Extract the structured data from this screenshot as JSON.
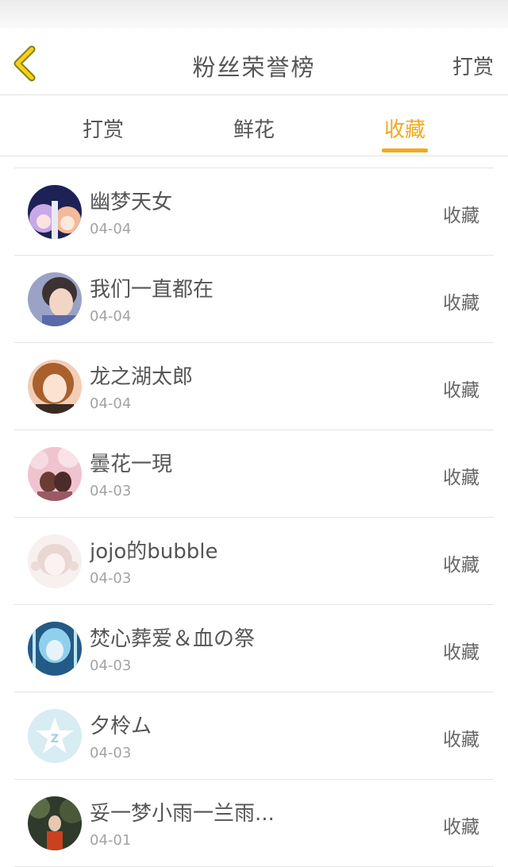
{
  "header": {
    "title": "粉丝荣誉榜",
    "right_action": "打赏",
    "back_icon": "chevron-left-icon",
    "accent": "#f2a91e"
  },
  "tabs": [
    {
      "label": "打赏",
      "active": false
    },
    {
      "label": "鲜花",
      "active": false
    },
    {
      "label": "收藏",
      "active": true
    }
  ],
  "fans": [
    {
      "name": "幽梦天女",
      "date": "04-04",
      "action": "收藏"
    },
    {
      "name": "我们一直都在",
      "date": "04-04",
      "action": "收藏"
    },
    {
      "name": "龙之湖太郎",
      "date": "04-04",
      "action": "收藏"
    },
    {
      "name": "曇花一現",
      "date": "04-03",
      "action": "收藏"
    },
    {
      "name": "jojo的bubble",
      "date": "04-03",
      "action": "收藏"
    },
    {
      "name": "焚心葬爱＆血の祭",
      "date": "04-03",
      "action": "收藏"
    },
    {
      "name": "夕柃ム",
      "date": "04-03",
      "action": "收藏"
    },
    {
      "name": "妥一梦小雨一兰雨...",
      "date": "04-01",
      "action": "收藏"
    }
  ]
}
